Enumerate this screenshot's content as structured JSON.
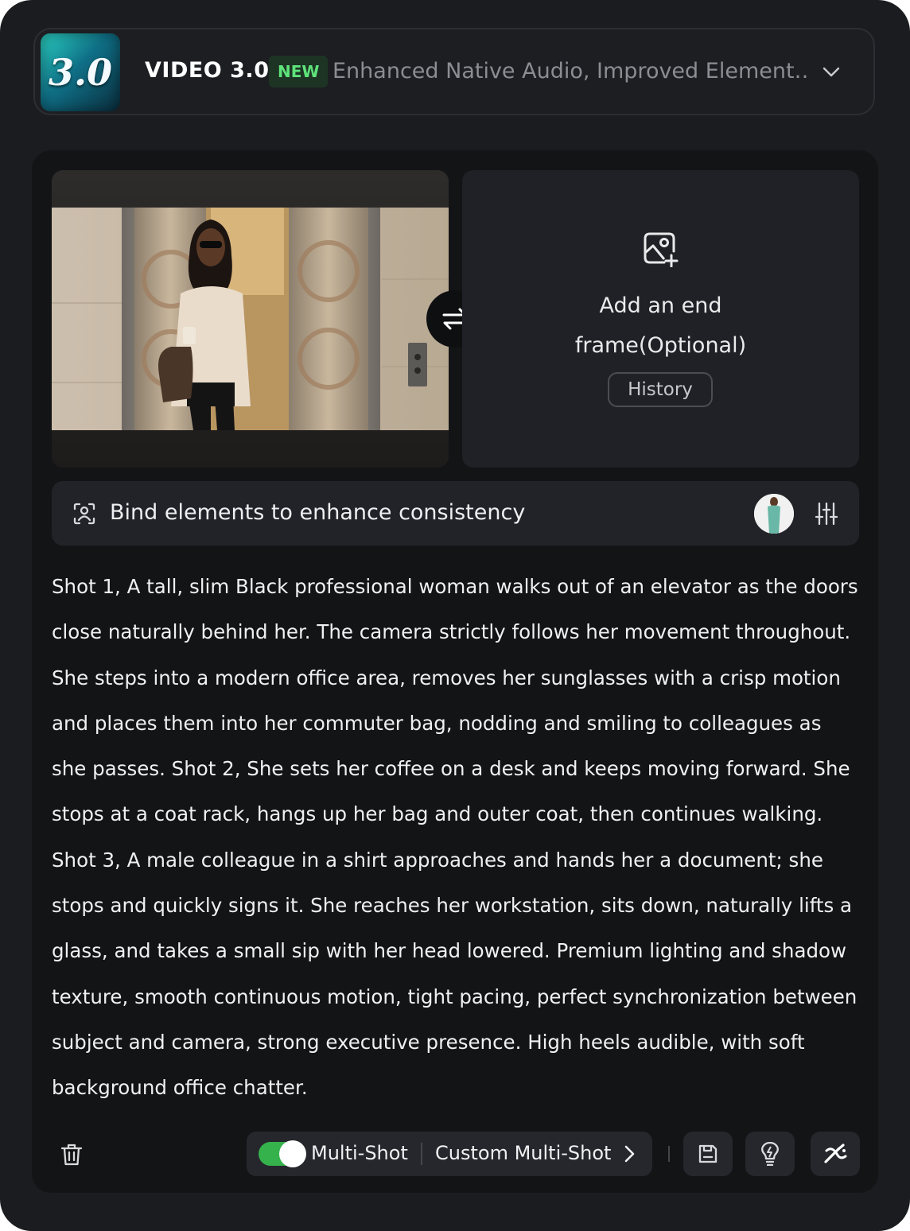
{
  "header": {
    "logo_text": "3.0",
    "model_name": "VIDEO 3.0",
    "badge": "NEW",
    "description": "Enhanced Native Audio, Improved Element…",
    "dropdown_icon": "chevron-down-icon"
  },
  "frames": {
    "start_image_alt": "Woman in sunglasses stepping out of an elevator holding a coffee cup",
    "swap_icon": "swap-icon",
    "end_icon": "add-image-icon",
    "end_label_line1": "Add an end",
    "end_label_line2": "frame(Optional)",
    "history_label": "History"
  },
  "bind": {
    "icon": "element-bind-icon",
    "label": "Bind elements to enhance consistency",
    "settings_icon": "sliders-icon"
  },
  "prompt": {
    "text": "Shot 1, A tall, slim Black professional woman walks out of an elevator as the doors close naturally behind her. The camera strictly follows her movement throughout. She steps into a modern office area, removes her sunglasses with a crisp motion and places them into her commuter bag, nodding and smiling to colleagues as she passes. Shot 2, She sets her coffee on a desk and keeps moving forward. She stops at a coat rack, hangs up her bag and outer coat, then continues walking. Shot 3, A male colleague in a shirt approaches and hands her a document; she stops and quickly signs it. She reaches her workstation, sits down, naturally lifts a glass, and takes a small sip with her head lowered. Premium lighting and shadow texture, smooth continuous motion, tight pacing, perfect synchronization between subject and camera, strong executive presence. High heels audible, with soft background office chatter."
  },
  "toolbar": {
    "delete_icon": "trash-icon",
    "multi_shot_label": "Multi-Shot",
    "multi_shot_enabled": true,
    "custom_label": "Custom Multi-Shot",
    "save_icon": "save-icon",
    "idea_icon": "lightbulb-icon",
    "generate_icon": "magic-icon"
  },
  "colors": {
    "background": "#1b1c1f",
    "card": "#131416",
    "accent_green": "#35b24c",
    "badge_text": "#5ee27a"
  }
}
